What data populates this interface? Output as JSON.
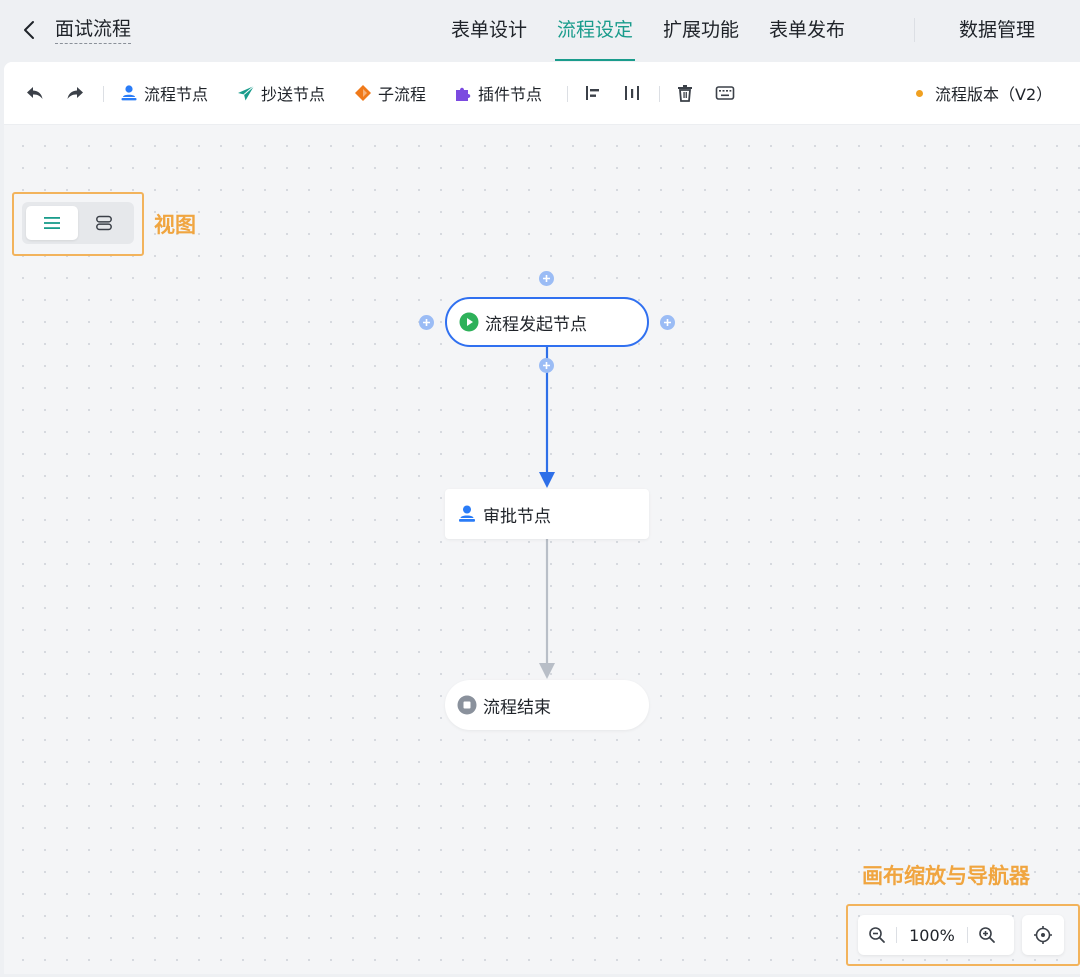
{
  "header": {
    "title": "面试流程",
    "tabs": [
      {
        "label": "表单设计",
        "active": false
      },
      {
        "label": "流程设定",
        "active": true
      },
      {
        "label": "扩展功能",
        "active": false
      },
      {
        "label": "表单发布",
        "active": false
      }
    ],
    "data_tab": "数据管理"
  },
  "toolbar": {
    "undo_icon": "undo-icon",
    "redo_icon": "redo-icon",
    "items": [
      {
        "label": "流程节点",
        "icon": "user-stamp-icon",
        "color": "#2a7cf7"
      },
      {
        "label": "抄送节点",
        "icon": "send-icon",
        "color": "#1a9c8c"
      },
      {
        "label": "子流程",
        "icon": "diamond-icon",
        "color": "#f07a1a"
      },
      {
        "label": "插件节点",
        "icon": "puzzle-icon",
        "color": "#7b4ae0"
      }
    ],
    "version": "流程版本（V2）",
    "version_dot_color": "#f0a020"
  },
  "view": {
    "annotation": "视图",
    "options": [
      {
        "icon": "list-view-icon",
        "active": true
      },
      {
        "icon": "card-view-icon",
        "active": false
      }
    ]
  },
  "flow": {
    "start_node": "流程发起节点",
    "approve_node": "审批节点",
    "end_node": "流程结束"
  },
  "zoom": {
    "annotation": "画布缩放与导航器",
    "value": "100%"
  },
  "colors": {
    "accent": "#1a9c8c",
    "annotation": "#f0a540",
    "primary_blue": "#3070f0"
  }
}
